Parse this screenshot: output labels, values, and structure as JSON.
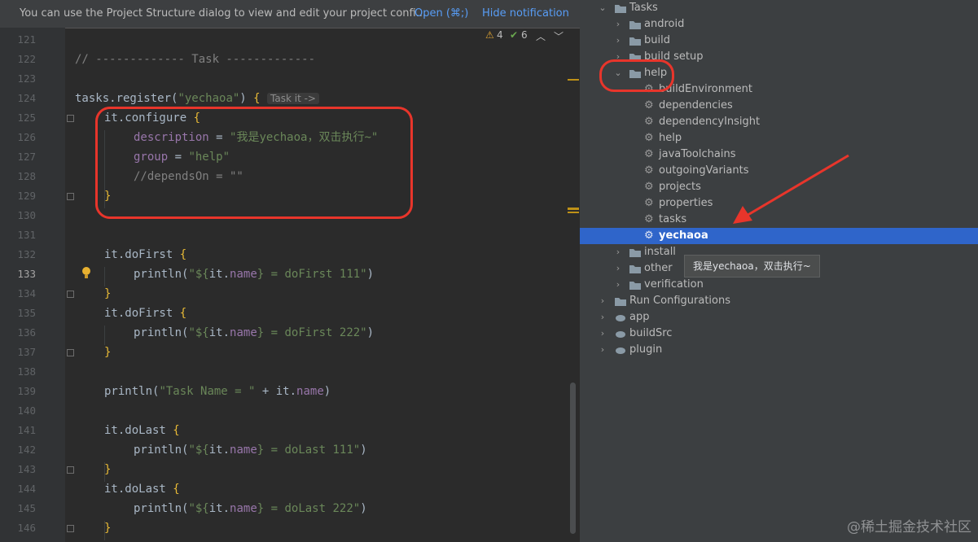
{
  "notification": {
    "message": "You can use the Project Structure dialog to view and edit your project confi...",
    "open_label": "Open (⌘;)",
    "hide_label": "Hide notification"
  },
  "inspections": {
    "warnings": "4",
    "weak": "6"
  },
  "editor": {
    "line_numbers": [
      "121",
      "122",
      "123",
      "124",
      "125",
      "126",
      "127",
      "128",
      "129",
      "130",
      "131",
      "132",
      "133",
      "134",
      "135",
      "136",
      "137",
      "138",
      "139",
      "140",
      "141",
      "142",
      "143",
      "144",
      "145",
      "146"
    ],
    "current_line": "133",
    "code": {
      "l122": "// ------------- Task -------------",
      "l124_a": "tasks.register(",
      "l124_b": "\"yechaoa\"",
      "l124_c": ") ",
      "l124_d": "{",
      "l124_hint": "Task it ->",
      "l125_a": "it.configure ",
      "l125_b": "{",
      "l126_a": "description",
      "l126_b": " = ",
      "l126_c": "\"我是yechaoa，双击执行~\"",
      "l127_a": "group",
      "l127_b": " = ",
      "l127_c": "\"help\"",
      "l128": "//dependsOn = \"\"",
      "l129": "}",
      "l132_a": "it.doFirst ",
      "l132_b": "{",
      "l133_a": "println(",
      "l133_b": "\"${",
      "l133_c": "it.",
      "l133_d": "name",
      "l133_e": "} = doFirst 111\"",
      "l133_f": ")",
      "l134": "}",
      "l135_a": "it.doFirst ",
      "l135_b": "{",
      "l136_a": "println(",
      "l136_b": "\"${",
      "l136_c": "it.",
      "l136_d": "name",
      "l136_e": "} = doFirst 222\"",
      "l136_f": ")",
      "l137": "}",
      "l139_a": "println(",
      "l139_b": "\"Task Name = \"",
      "l139_c": " + it.",
      "l139_d": "name",
      "l139_e": ")",
      "l141_a": "it.doLast ",
      "l141_b": "{",
      "l142_a": "println(",
      "l142_b": "\"${",
      "l142_c": "it.",
      "l142_d": "name",
      "l142_e": "} = doLast 111\"",
      "l142_f": ")",
      "l143": "}",
      "l144_a": "it.doLast ",
      "l144_b": "{",
      "l145_a": "println(",
      "l145_b": "\"${",
      "l145_c": "it.",
      "l145_d": "name",
      "l145_e": "} = doLast 222\"",
      "l145_f": ")",
      "l146": "}"
    }
  },
  "gradle_tree": {
    "tasks": "Tasks",
    "android": "android",
    "build": "build",
    "build_setup": "build setup",
    "help": "help",
    "help_items": [
      "buildEnvironment",
      "dependencies",
      "dependencyInsight",
      "help",
      "javaToolchains",
      "outgoingVariants",
      "projects",
      "properties",
      "tasks"
    ],
    "selected": "yechaoa",
    "install": "install",
    "other": "other",
    "verification": "verification",
    "run_configurations": "Run Configurations",
    "app": "app",
    "buildSrc": "buildSrc",
    "plugin": "plugin"
  },
  "tooltip": "我是yechaoa，双击执行~",
  "watermark": "@稀土掘金技术社区",
  "colors": {
    "annotation": "#e8352b",
    "selection": "#2f65ca",
    "link": "#589df6"
  }
}
